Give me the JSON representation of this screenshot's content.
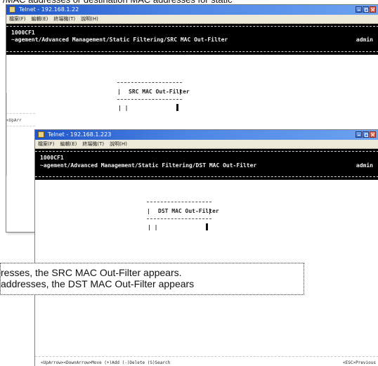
{
  "page": {
    "top_caption": "/MAC addresses or destination MAC addresses for static"
  },
  "windows": [
    {
      "title": "Telnet - 192.168.1.22",
      "menu_items": [
        "檔案(F)",
        "編輯(E)",
        "終端機(T)",
        "說明(H)"
      ],
      "device_name": "1000CF1",
      "path": "~agement/Advanced Management/Static Filtering/SRC MAC Out-Filter",
      "user": "admin",
      "dialog_title": "SRC MAC Out-Filter",
      "entry_value": "| |",
      "side_help": "<UpArr"
    },
    {
      "title": "Telnet - 192.168.1.223",
      "menu_items": [
        "檔案(F)",
        "編輯(E)",
        "終端機(T)",
        "說明(H)"
      ],
      "device_name": "1000CF1",
      "path": "~agement/Advanced Management/Static Filtering/DST MAC Out-Filter",
      "user": "admin",
      "dialog_title": "DST MAC Out-Filter",
      "entry_value": "| |",
      "footer_left": "<UpArrow><DownArrow>Move (+)Add (-)Delete (S)Search",
      "footer_right": "<ESC>Previous"
    }
  ],
  "caption": {
    "line_1": "resses, the SRC MAC Out-Filter appears.",
    "line_2": "addresses, the DST MAC Out-Filter appears"
  },
  "icons": {
    "telnet": "terminal-window-icon",
    "minimize": "minimize-icon",
    "maximize": "maximize-icon",
    "close": "close-icon"
  },
  "colors": {
    "titlebar_start": "#1f55c9",
    "titlebar_end": "#6da2f0",
    "terminal_header": "#000000",
    "close_button": "#d54c36"
  }
}
